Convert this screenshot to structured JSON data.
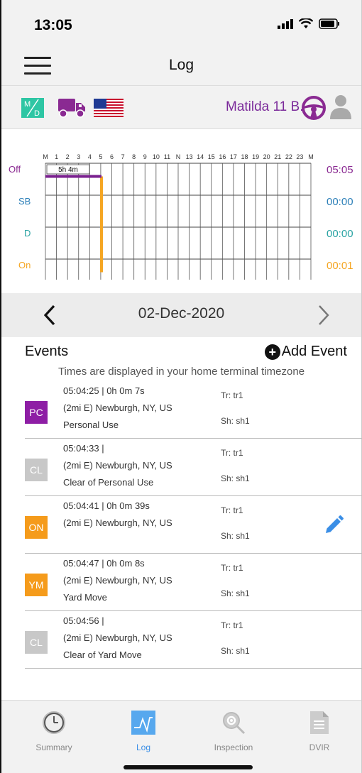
{
  "status_bar": {
    "time": "13:05"
  },
  "header": {
    "title": "Log"
  },
  "driver": {
    "name": "Matilda 11 B."
  },
  "chart_data": {
    "type": "gantt",
    "hour_labels": [
      "M",
      "1",
      "2",
      "3",
      "4",
      "5",
      "6",
      "7",
      "8",
      "9",
      "10",
      "11",
      "N",
      "13",
      "14",
      "15",
      "16",
      "17",
      "18",
      "19",
      "20",
      "21",
      "22",
      "23",
      "M"
    ],
    "rows": [
      {
        "label": "Off",
        "total": "05:05",
        "color": "#8a2a92"
      },
      {
        "label": "SB",
        "total": "00:00",
        "color": "#2c7fb8"
      },
      {
        "label": "D",
        "total": "00:00",
        "color": "#29a3a3"
      },
      {
        "label": "On",
        "total": "00:01",
        "color": "#f5a623"
      }
    ],
    "segments": [
      {
        "status": "Off",
        "start_hour": 0,
        "end_hour": 5.07,
        "color": "#7a1f8f"
      }
    ],
    "transitions": [
      {
        "hour": 5.07,
        "from": "Off",
        "to": "On",
        "color": "#f5a623"
      }
    ],
    "annotation": "5h 4m"
  },
  "date_nav": {
    "date": "02-Dec-2020"
  },
  "events_section": {
    "title": "Events",
    "add_label": "Add Event",
    "timezone_note": "Times are displayed in your home terminal timezone"
  },
  "events": [
    {
      "code": "PC",
      "color": "#8e1ea5",
      "time": "05:04:25 | 0h 0m 7s",
      "location": "(2mi E) Newburgh, NY, US",
      "note": "Personal Use",
      "tr": "Tr: tr1",
      "sh": "Sh: sh1"
    },
    {
      "code": "CL",
      "color": "#c8c8c8",
      "time": "05:04:33 |",
      "location": "(2mi E) Newburgh, NY, US",
      "note": "Clear of Personal Use",
      "tr": "Tr: tr1",
      "sh": "Sh: sh1"
    },
    {
      "code": "ON",
      "color": "#f59b1b",
      "time": "05:04:41 | 0h 0m 39s",
      "location": "(2mi E) Newburgh, NY, US",
      "note": "",
      "tr": "Tr: tr1",
      "sh": "Sh: sh1"
    },
    {
      "code": "YM",
      "color": "#f59b1b",
      "time": "05:04:47 | 0h 0m 8s",
      "location": "(2mi E) Newburgh, NY, US",
      "note": "Yard Move",
      "tr": "Tr: tr1",
      "sh": "Sh: sh1"
    },
    {
      "code": "CL",
      "color": "#c8c8c8",
      "time": "05:04:56 |",
      "location": "(2mi E) Newburgh, NY, US",
      "note": "Clear of Yard Move",
      "tr": "Tr: tr1",
      "sh": "Sh: sh1"
    }
  ],
  "tabs": [
    {
      "label": "Summary",
      "icon": "clock-icon"
    },
    {
      "label": "Log",
      "icon": "graph-icon",
      "active": true
    },
    {
      "label": "Inspection",
      "icon": "magnifier-gear-icon"
    },
    {
      "label": "DVIR",
      "icon": "document-icon"
    }
  ],
  "colors": {
    "accent": "#3a8ee6",
    "driver": "#7b2a9a",
    "status_on": "#f5a623",
    "status_off": "#7a1f8f"
  }
}
